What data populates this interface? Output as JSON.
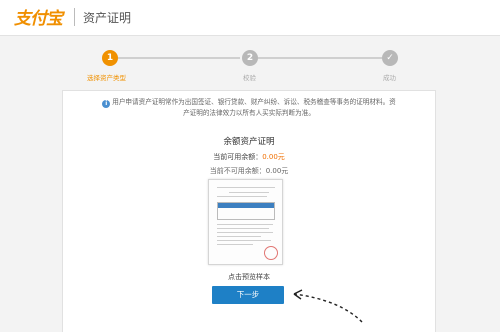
{
  "header": {
    "logo_text": "支付宝",
    "title": "资产证明"
  },
  "steps": [
    {
      "number": "1",
      "label": "选择资产类型",
      "status": "active"
    },
    {
      "number": "2",
      "label": "校验",
      "status": "pending"
    },
    {
      "number": "",
      "label": "成功",
      "status": "pending"
    }
  ],
  "notice": {
    "text": "用户申请资产证明常作为出国签证、银行贷款、财产纠纷、诉讼、税务稽查等事务的证明材料。资产证明的法律效力以所有人买实际判断为准。"
  },
  "certificate": {
    "title": "余额资产证明",
    "available_label": "当前可用余额：",
    "available_value": "0.00元",
    "unavailable_label": "当前不可用余额：",
    "unavailable_value": "0.00元",
    "preview_label": "点击预览样本"
  },
  "actions": {
    "next_label": "下一步"
  },
  "colors": {
    "accent": "#f09100",
    "button": "#1e80c6",
    "amount": "#f06f00"
  }
}
